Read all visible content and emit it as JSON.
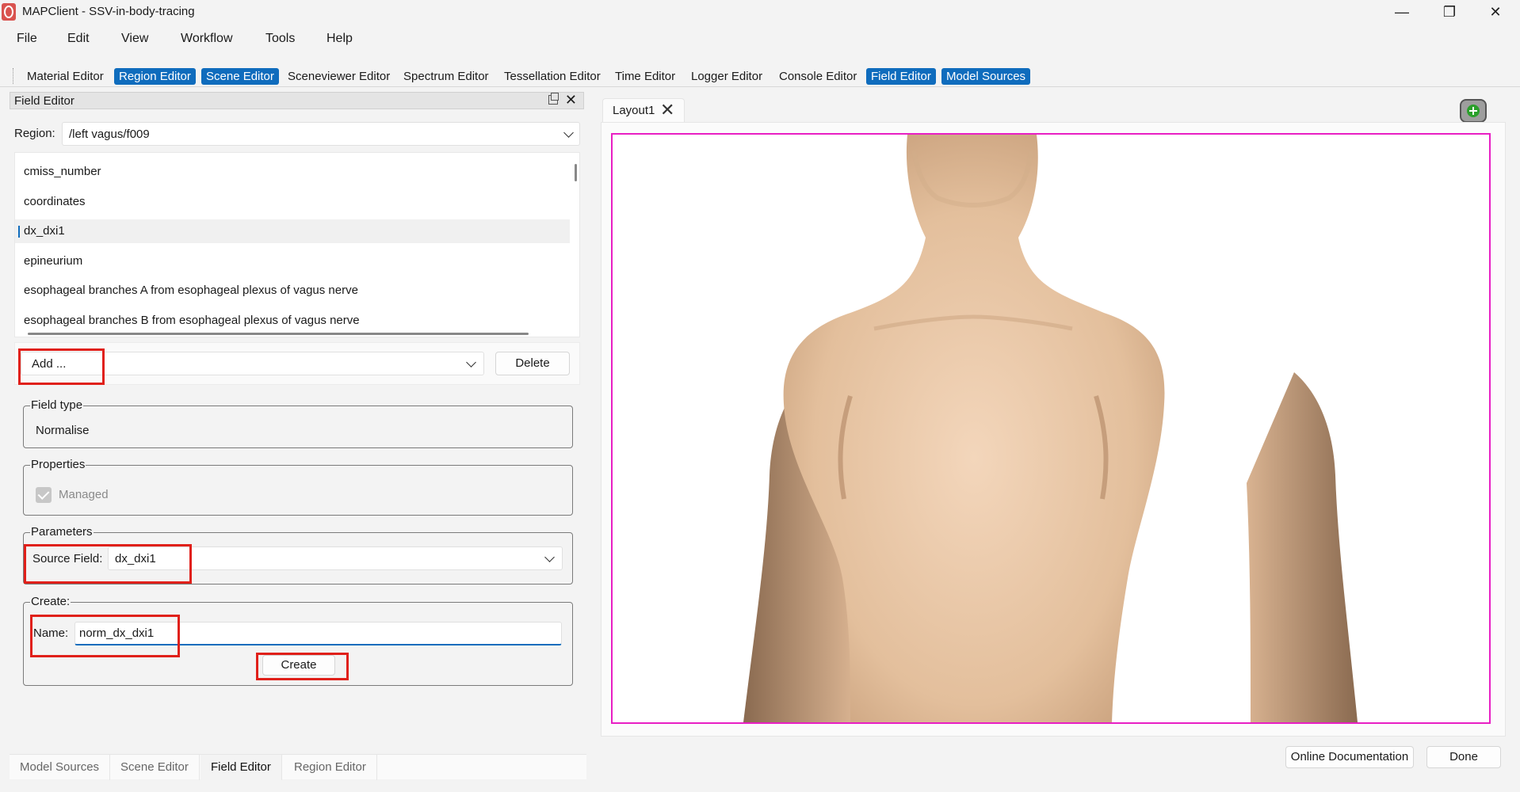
{
  "window": {
    "title": "MAPClient - SSV-in-body-tracing",
    "minimize_glyph": "—",
    "restore_glyph": "❐",
    "close_glyph": "✕"
  },
  "menu": [
    "File",
    "Edit",
    "View",
    "Workflow",
    "Tools",
    "Help"
  ],
  "toolbar": {
    "buttons": [
      {
        "label": "Material Editor",
        "active": false
      },
      {
        "label": "Region Editor",
        "active": true
      },
      {
        "label": "Scene Editor",
        "active": true
      },
      {
        "label": "Sceneviewer Editor",
        "active": false
      },
      {
        "label": "Spectrum Editor",
        "active": false
      },
      {
        "label": "Tessellation Editor",
        "active": false
      },
      {
        "label": "Time Editor",
        "active": false
      },
      {
        "label": "Logger Editor",
        "active": false
      },
      {
        "label": "Console Editor",
        "active": false
      },
      {
        "label": "Field Editor",
        "active": true
      },
      {
        "label": "Model Sources",
        "active": true
      }
    ]
  },
  "dock": {
    "title": "Field Editor",
    "close_glyph": "✕"
  },
  "field_editor": {
    "region_label": "Region:",
    "region_value": "/left vagus/f009",
    "fields": [
      "cmiss_number",
      "coordinates",
      "dx_dxi1",
      "epineurium",
      "esophageal branches A from esophageal plexus of vagus nerve",
      "esophageal branches B from esophageal plexus of vagus nerve"
    ],
    "selected_field": "dx_dxi1",
    "add_label": "Add ...",
    "delete_label": "Delete",
    "field_type_title": "Field type",
    "field_type_value": "Normalise",
    "properties_title": "Properties",
    "managed_label": "Managed",
    "managed_checked": true,
    "parameters_title": "Parameters",
    "source_field_label": "Source Field:",
    "source_field_value": "dx_dxi1",
    "create_title": "Create:",
    "name_label": "Name:",
    "name_value": "norm_dx_dxi1",
    "create_button": "Create"
  },
  "bottom_tabs": [
    {
      "label": "Model Sources",
      "active": false
    },
    {
      "label": "Scene Editor",
      "active": false
    },
    {
      "label": "Field Editor",
      "active": true
    },
    {
      "label": "Region Editor",
      "active": false
    }
  ],
  "layout": {
    "tab_label": "Layout1",
    "tab_close_glyph": "✕"
  },
  "footer": {
    "docs_button": "Online Documentation",
    "done_button": "Done"
  },
  "colors": {
    "accent": "#0f6cbd",
    "highlight_box": "#e0201a",
    "viewport_border": "#e81fc4",
    "skin": "#e6c4a3"
  }
}
